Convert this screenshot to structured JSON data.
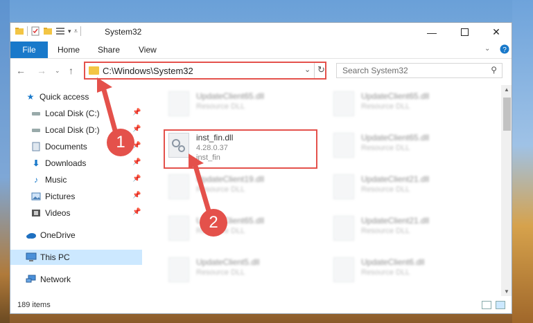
{
  "window": {
    "title": "System32"
  },
  "ribbon": {
    "file": "File",
    "tabs": [
      "Home",
      "Share",
      "View"
    ]
  },
  "address": {
    "path": "C:\\Windows\\System32",
    "search_placeholder": "Search System32"
  },
  "nav": {
    "items": [
      {
        "label": "Quick access",
        "icon": "star-icon",
        "pinned": false
      },
      {
        "label": "Local Disk (C:)",
        "icon": "drive-icon",
        "pinned": true
      },
      {
        "label": "Local Disk (D:)",
        "icon": "drive-icon",
        "pinned": true
      },
      {
        "label": "Documents",
        "icon": "documents-icon",
        "pinned": true
      },
      {
        "label": "Downloads",
        "icon": "download-icon",
        "pinned": true
      },
      {
        "label": "Music",
        "icon": "music-icon",
        "pinned": true
      },
      {
        "label": "Pictures",
        "icon": "pictures-icon",
        "pinned": true
      },
      {
        "label": "Videos",
        "icon": "videos-icon",
        "pinned": true
      },
      {
        "label": "OneDrive",
        "icon": "onedrive-icon",
        "pinned": false
      },
      {
        "label": "This PC",
        "icon": "computer-icon",
        "pinned": false
      },
      {
        "label": "Network",
        "icon": "network-icon",
        "pinned": false
      }
    ]
  },
  "files": {
    "highlighted": {
      "name": "inst_fin.dll",
      "version": "4.28.0.37",
      "desc": "inst_fin"
    },
    "blurred": [
      {
        "name": "UpdateClient65.dll",
        "desc": "Resource DLL"
      },
      {
        "name": "UpdateClient65.dll",
        "desc": "Resource DLL"
      },
      {
        "name": "UpdateClient65.dll",
        "desc": "Resource DLL"
      },
      {
        "name": "UpdateClient19.dll",
        "desc": "Resource DLL"
      },
      {
        "name": "UpdateClient21.dll",
        "desc": "Resource DLL"
      },
      {
        "name": "UpdateClient65.dll",
        "desc": "Resource DLL"
      },
      {
        "name": "UpdateClient21.dll",
        "desc": "Resource DLL"
      },
      {
        "name": "UpdateClient5.dll",
        "desc": "Resource DLL"
      },
      {
        "name": "UpdateClient6.dll",
        "desc": "Resource DLL"
      }
    ]
  },
  "status": {
    "count": "189 items"
  },
  "annotations": {
    "badge1": "1",
    "badge2": "2",
    "color": "#e4514b"
  }
}
